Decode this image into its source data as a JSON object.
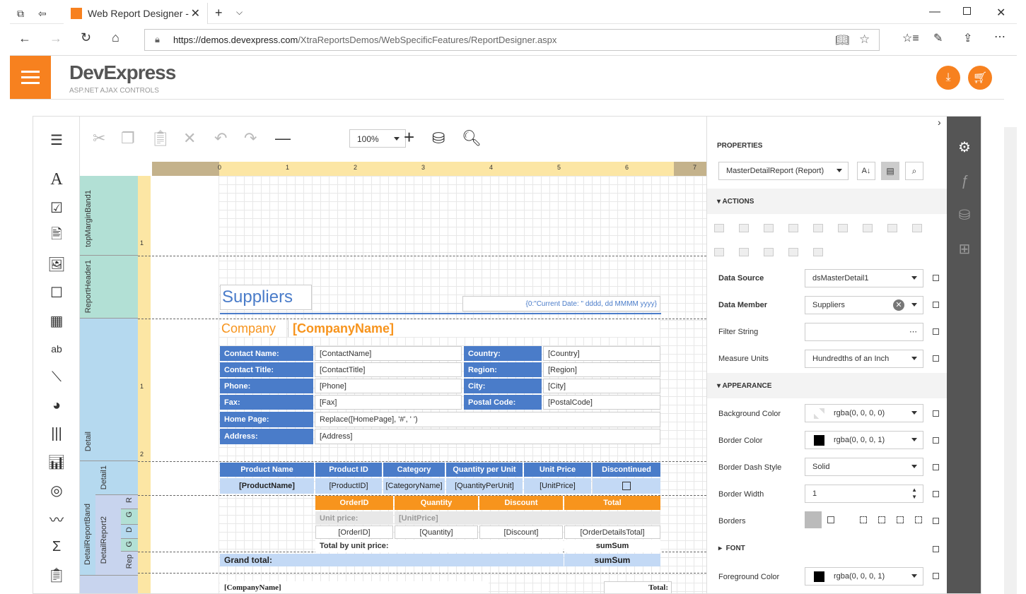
{
  "browser": {
    "tab_title": "Web Report Designer -",
    "url_domain": "https://demos.devexpress.com",
    "url_path": "/XtraReportsDemos/WebSpecificFeatures/ReportDesigner.aspx"
  },
  "app": {
    "brand": "DevExpress",
    "sub": "ASP.NET AJAX CONTROLS"
  },
  "toolbar": {
    "zoom": "100%"
  },
  "ruler": {
    "h": [
      "0",
      "1",
      "2",
      "3",
      "4",
      "5",
      "6",
      "7"
    ],
    "v1": "1",
    "v2": "1",
    "v3": "2"
  },
  "bands": {
    "top": "topMarginBand1",
    "rh": "ReportHeader1",
    "detail": "Detail",
    "detail1": "Detail1",
    "drb": "DetailReportBand",
    "dr2": "DetailReport2",
    "r": "R",
    "g": "G",
    "d": "D",
    "g2": "G",
    "rep": "Rep"
  },
  "report": {
    "title": "Suppliers",
    "date": "{0:\"Current Date: \" dddd, dd MMMM yyyy}",
    "company_lbl": "Company",
    "company_val": "[CompanyName]",
    "fields": [
      {
        "l": "Contact Name:",
        "v": "[ContactName]",
        "l2": "Country:",
        "v2": "[Country]"
      },
      {
        "l": "Contact Title:",
        "v": "[ContactTitle]",
        "l2": "Region:",
        "v2": "[Region]"
      },
      {
        "l": "Phone:",
        "v": "[Phone]",
        "l2": "City:",
        "v2": "[City]"
      },
      {
        "l": "Fax:",
        "v": "[Fax]",
        "l2": "Postal Code:",
        "v2": "[PostalCode]"
      }
    ],
    "home_lbl": "Home Page:",
    "home_val": "Replace([HomePage], '#', ' ')",
    "addr_lbl": "Address:",
    "addr_val": "[Address]",
    "prod_hdr": [
      "Product Name",
      "Product ID",
      "Category",
      "Quantity per Unit",
      "Unit Price",
      "Discontinued"
    ],
    "prod_row": [
      "[ProductName]",
      "[ProductID]",
      "[CategoryName]",
      "[QuantityPerUnit]",
      "[UnitPrice]"
    ],
    "ord_hdr": [
      "OrderID",
      "Quantity",
      "Discount",
      "Total"
    ],
    "unit_lbl": "Unit price:",
    "unit_val": "[UnitPrice]",
    "ord_row": [
      "[OrderID]",
      "[Quantity]",
      "[Discount]",
      "[OrderDetailsTotal]"
    ],
    "tbu": "Total by unit price:",
    "sumsum": "sumSum",
    "grand": "Grand total:",
    "sumsum2": "sumSum",
    "footer_company": "[CompanyName]",
    "footer_total": "Total:"
  },
  "props": {
    "title": "PROPERTIES",
    "selector": "MasterDetailReport (Report)",
    "actions": "ACTIONS",
    "appearance": "APPEARANCE",
    "font": "FONT",
    "rows": [
      {
        "l": "Data Source",
        "v": "dsMasterDetail1"
      },
      {
        "l": "Data Member",
        "v": "Suppliers"
      },
      {
        "l": "Filter String",
        "v": ""
      },
      {
        "l": "Measure Units",
        "v": "Hundredths of an Inch"
      }
    ],
    "arows": [
      {
        "l": "Background Color",
        "v": "rgba(0, 0, 0, 0)"
      },
      {
        "l": "Border Color",
        "v": "rgba(0, 0, 0, 1)"
      },
      {
        "l": "Border Dash Style",
        "v": "Solid"
      },
      {
        "l": "Border Width",
        "v": "1"
      },
      {
        "l": "Borders",
        "v": ""
      }
    ],
    "fg_l": "Foreground Color",
    "fg_v": "rgba(0, 0, 0, 1)"
  }
}
